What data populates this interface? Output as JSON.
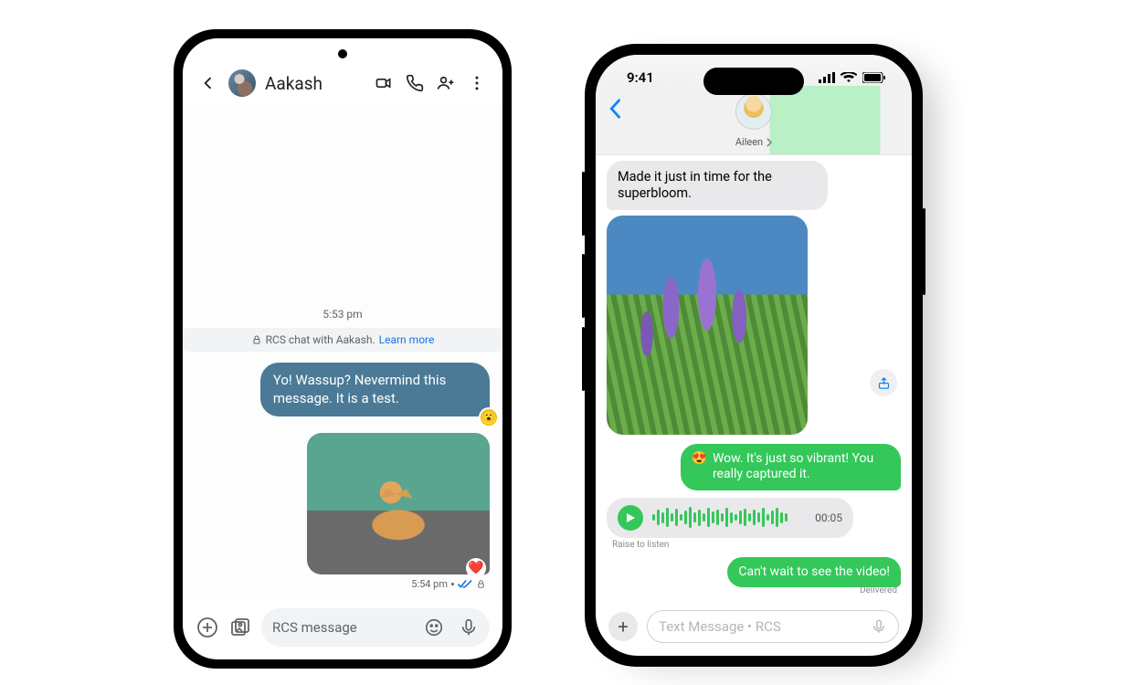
{
  "android": {
    "contact": "Aakash",
    "timestamp": "5:53 pm",
    "banner_prefix": "RCS chat with Aakash.",
    "banner_link": "Learn more",
    "sent_text": "Yo! Wassup? Nevermind this message. It is a test.",
    "reaction1": "😮",
    "reaction2": "❤️",
    "sent_image_alt": "cat-photo",
    "sent_meta_time": "5:54 pm",
    "input_placeholder": "RCS message"
  },
  "iphone": {
    "status_time": "9:41",
    "contact": "Aileen",
    "recv_text": "Made it just in time for the superbloom.",
    "recv_image_alt": "lavender-flowers-photo",
    "sent1_emoji": "😍",
    "sent1_text": "Wow. It's just so vibrant! You really captured it.",
    "voice_duration": "00:05",
    "raise_hint": "Raise to listen",
    "sent2_text": "Can't wait to see the video!",
    "delivered": "Delivered",
    "input_placeholder": "Text Message • RCS"
  }
}
